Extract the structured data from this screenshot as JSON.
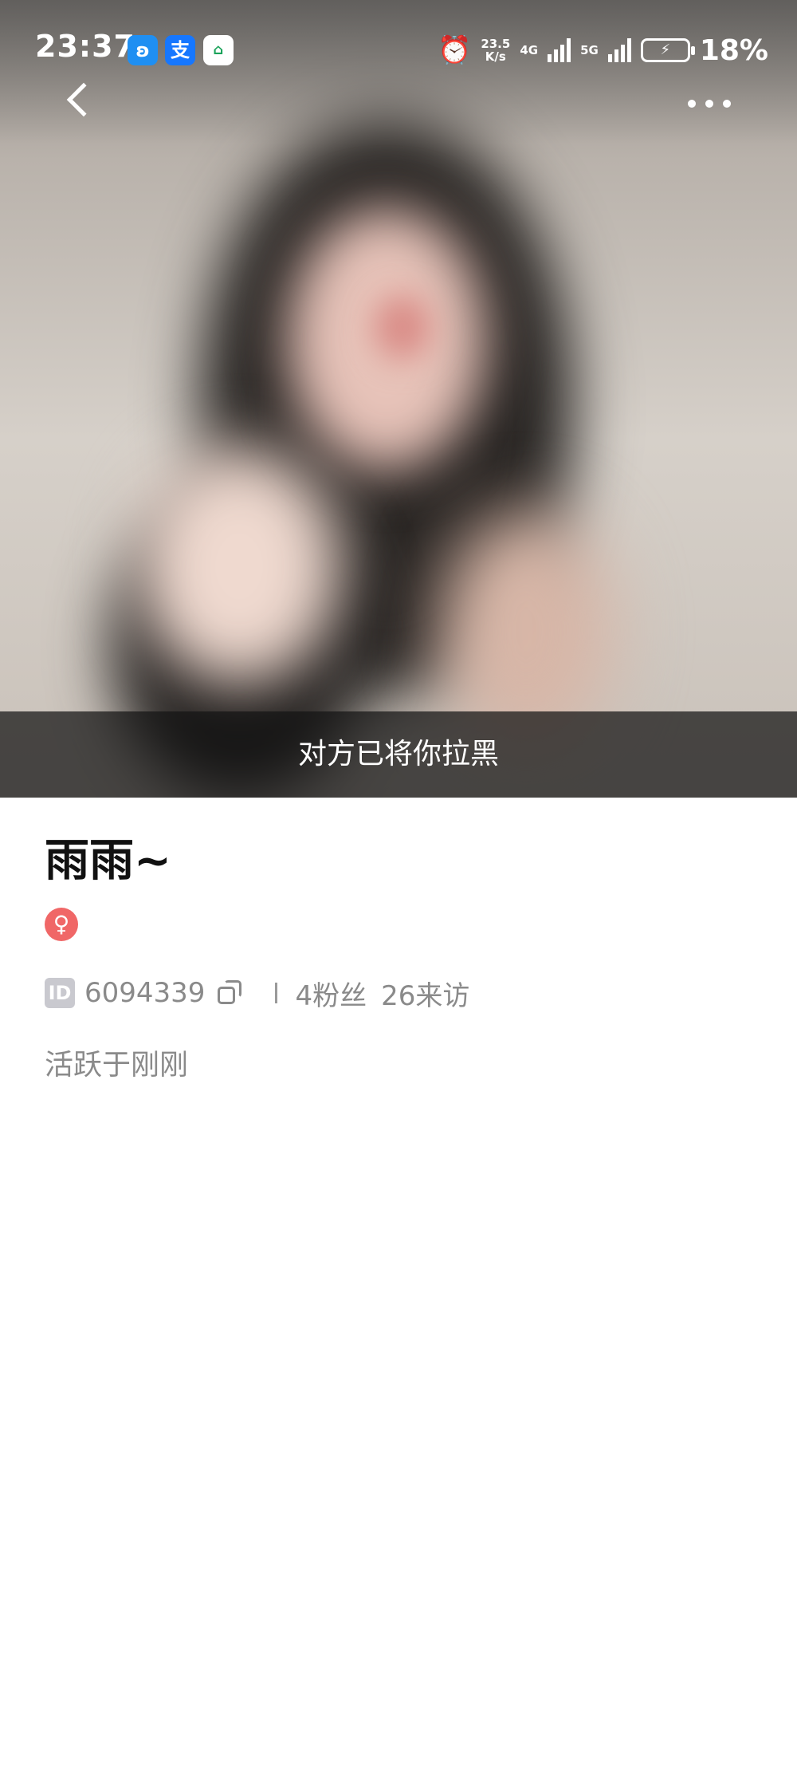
{
  "status_bar": {
    "time": "23:37",
    "app_icons": [
      "baidu-app-icon",
      "alipay-app-icon",
      "home-app-icon"
    ],
    "app_icon_glyphs": [
      "ʚ",
      "支",
      "⌂"
    ],
    "alarm": "⏰",
    "net_speed_value": "23.5",
    "net_speed_unit": "K/s",
    "network_4g": "4G",
    "network_5g": "5G",
    "battery_percent": "18%"
  },
  "nav": {
    "back_icon": "back-arrow-icon",
    "more_icon": "more-dots-icon"
  },
  "banner": {
    "text": "对方已将你拉黑"
  },
  "profile": {
    "name": "雨雨~",
    "gender_symbol": "♀",
    "id_label": "ID",
    "id_value": "6094339",
    "fans": "4粉丝",
    "visits": "26来访",
    "active_status": "活跃于刚刚"
  },
  "colors": {
    "gender_badge": "#f06767",
    "secondary_text": "#8a8a8a",
    "banner_bg": "#141414"
  }
}
